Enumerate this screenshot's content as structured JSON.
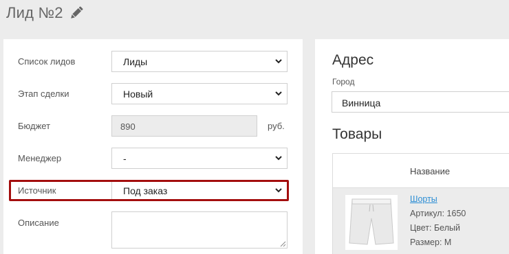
{
  "header": {
    "title": "Лид №2"
  },
  "form": {
    "lead_list": {
      "label": "Список лидов",
      "value": "Лиды"
    },
    "deal_stage": {
      "label": "Этап сделки",
      "value": "Новый"
    },
    "budget": {
      "label": "Бюджет",
      "value": "890",
      "currency": "руб."
    },
    "manager": {
      "label": "Менеджер",
      "value": "-"
    },
    "source": {
      "label": "Источник",
      "value": "Под заказ"
    },
    "description": {
      "label": "Описание",
      "value": ""
    }
  },
  "address": {
    "title": "Адрес",
    "city_label": "Город",
    "city_value": "Винница"
  },
  "products": {
    "title": "Товары",
    "column_name": "Название",
    "items": [
      {
        "name": "Шорты",
        "sku": "Артикул: 1650",
        "color": "Цвет: Белый",
        "size": "Размер: M"
      }
    ]
  },
  "colors": {
    "highlight": "#a30d0d",
    "link": "#2a8dd4",
    "background": "#ececec"
  },
  "icons": {
    "edit": "pencil-icon",
    "select_arrow": "chevron-down-icon"
  }
}
